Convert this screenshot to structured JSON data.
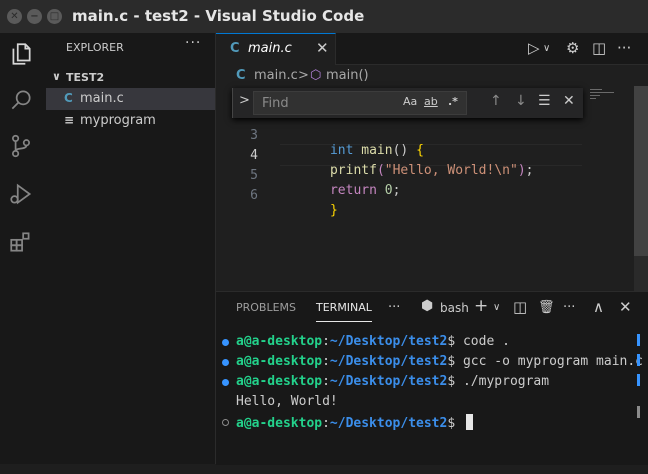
{
  "window": {
    "title": "main.c - test2 - Visual Studio Code",
    "close_glyph": "✕",
    "minimize_glyph": "−",
    "maximize_glyph": "□"
  },
  "activity_bar": {
    "items": [
      "explorer-icon",
      "search-icon",
      "source-control-icon",
      "run-debug-icon",
      "extensions-icon"
    ]
  },
  "sidebar": {
    "header": "EXPLORER",
    "more": "···",
    "folder_chevron": "∨",
    "folder": "TEST2",
    "files": [
      {
        "icon": "C",
        "name": "main.c",
        "active": true,
        "icon_color": "#519aba"
      },
      {
        "icon": "≡",
        "name": "myprogram",
        "active": false,
        "icon_color": "#cccccc"
      }
    ]
  },
  "editor": {
    "tab": {
      "icon": "C",
      "label": "main.c",
      "close": "✕"
    },
    "toolbar": {
      "run": "▷",
      "run_dropdown": "∨",
      "settings": "⚙",
      "split": "◫",
      "more": "···"
    },
    "breadcrumb": {
      "file_icon": "C",
      "file": "main.c",
      "separator": ">",
      "symbol_icon": "⬡",
      "symbol": "main()"
    },
    "find": {
      "expand": ">",
      "placeholder": "Find",
      "match_case": "Aa",
      "whole_word": "ab",
      "regex": ".*",
      "prev": "↑",
      "next": "↓",
      "selection": "☰",
      "close": "✕"
    },
    "lines": [
      {
        "num": "3",
        "tokens": [
          {
            "t": "int ",
            "c": "kw"
          },
          {
            "t": "main",
            "c": "fn"
          },
          {
            "t": "() ",
            "c": "pl"
          },
          {
            "t": "{",
            "c": "br"
          }
        ]
      },
      {
        "num": "4",
        "tokens": [
          {
            "t": "printf",
            "c": "fn"
          },
          {
            "t": "(",
            "c": "ct"
          },
          {
            "t": "\"Hello, World!\\n\"",
            "c": "st"
          },
          {
            "t": ")",
            "c": "ct"
          },
          {
            "t": ";",
            "c": "pl"
          }
        ]
      },
      {
        "num": "5",
        "tokens": [
          {
            "t": "return ",
            "c": "ct"
          },
          {
            "t": "0",
            "c": "nu"
          },
          {
            "t": ";",
            "c": "pl"
          }
        ]
      },
      {
        "num": "6",
        "tokens": [
          {
            "t": "}",
            "c": "br"
          }
        ]
      }
    ],
    "current_line": "4"
  },
  "panel": {
    "tabs": [
      "PROBLEMS",
      "TERMINAL"
    ],
    "active_tab": "TERMINAL",
    "more": "···",
    "shell_icon": "⬢",
    "shell": "bash",
    "add": "+",
    "add_dropdown": "∨",
    "split": "◫",
    "trash": "🗑",
    "more2": "···",
    "maximize": "∧",
    "close": "✕",
    "terminal_lines": [
      {
        "dot": "blue",
        "user": "a@a-desktop",
        "colon": ":",
        "path": "~/Desktop/test2",
        "prompt": "$ ",
        "cmd": "code ."
      },
      {
        "dot": "blue",
        "user": "a@a-desktop",
        "colon": ":",
        "path": "~/Desktop/test2",
        "prompt": "$ ",
        "cmd": "gcc -o myprogram main.c"
      },
      {
        "dot": "blue",
        "user": "a@a-desktop",
        "colon": ":",
        "path": "~/Desktop/test2",
        "prompt": "$ ",
        "cmd": "./myprogram"
      },
      {
        "dot": "none",
        "output": "Hello, World!"
      },
      {
        "dot": "empty",
        "user": "a@a-desktop",
        "colon": ":",
        "path": "~/Desktop/test2",
        "prompt": "$ ",
        "cmd": ""
      }
    ]
  }
}
